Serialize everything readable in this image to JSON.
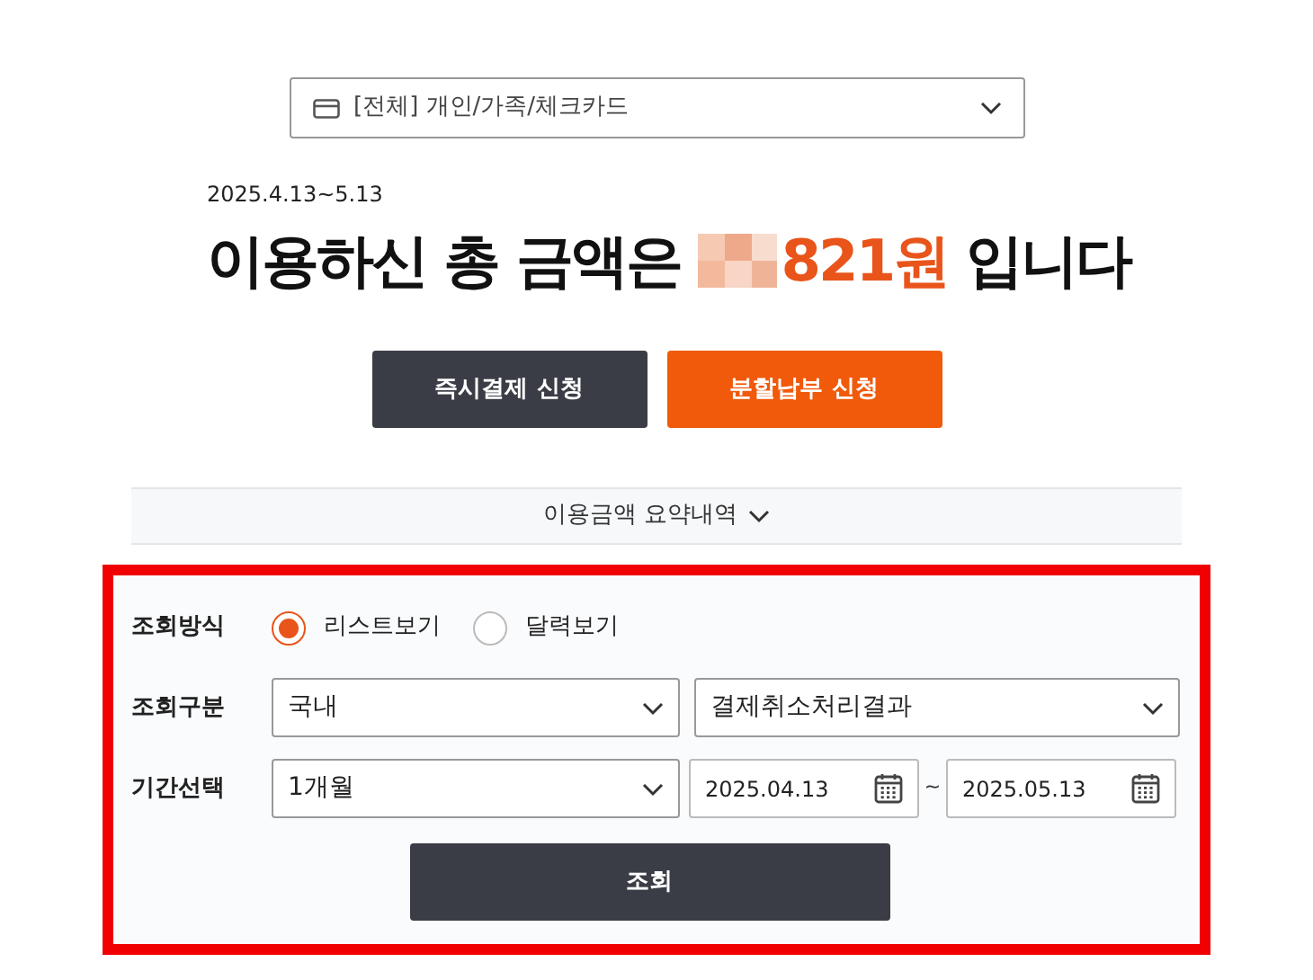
{
  "card_select": {
    "value": "[전체] 개인/가족/체크카드"
  },
  "period": "2025.4.13~5.13",
  "headline": {
    "prefix": "이용하신 총 금액은",
    "amount": "821원",
    "suffix": "입니다"
  },
  "buttons": [
    {
      "label": "즉시결제 신청",
      "kind": "dark"
    },
    {
      "label": "분할납부 신청",
      "kind": "orange"
    }
  ],
  "summary_toggle": {
    "label": "이용금액 요약내역",
    "expanded": false
  },
  "form": {
    "view_mode": {
      "label": "조회방식",
      "options": [
        {
          "label": "리스트보기",
          "selected": true
        },
        {
          "label": "달력보기",
          "selected": false
        }
      ]
    },
    "category": {
      "label": "조회구분",
      "selects": [
        "국내",
        "결제취소처리결과"
      ]
    },
    "period": {
      "label": "기간선택",
      "select": "1개월",
      "start": "2025.04.13",
      "separator": "~",
      "end": "2025.05.13"
    },
    "submit": "조회"
  }
}
